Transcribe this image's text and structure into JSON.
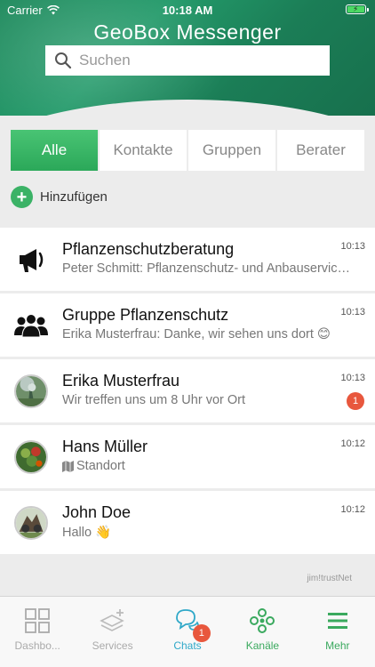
{
  "status_bar": {
    "carrier": "Carrier",
    "time": "10:18 AM"
  },
  "header": {
    "title": "GeoBox Messenger"
  },
  "search": {
    "placeholder": "Suchen",
    "value": ""
  },
  "segments": [
    {
      "label": "Alle",
      "active": true
    },
    {
      "label": "Kontakte",
      "active": false
    },
    {
      "label": "Gruppen",
      "active": false
    },
    {
      "label": "Berater",
      "active": false
    }
  ],
  "add": {
    "label": "Hinzufügen"
  },
  "chats": [
    {
      "name": "Pflanzenschutzberatung",
      "preview": "Peter Schmitt: Pflanzenschutz- und Anbauservice ...",
      "time": "10:13",
      "icon": "megaphone-icon"
    },
    {
      "name": "Gruppe Pflanzenschutz",
      "preview": "Erika Musterfrau: Danke, wir sehen uns dort 😊",
      "time": "10:13",
      "icon": "group-icon"
    },
    {
      "name": "Erika Musterfrau",
      "preview": "Wir treffen uns um 8 Uhr vor Ort",
      "time": "10:13",
      "unread": "1",
      "icon": "avatar-photo"
    },
    {
      "name": "Hans Müller",
      "preview": "Standort",
      "time": "10:12",
      "icon": "avatar-photo"
    },
    {
      "name": "John Doe",
      "preview": "Hallo 👋",
      "time": "10:12",
      "icon": "avatar-photo"
    }
  ],
  "footer": {
    "brand": "jim!trustNet"
  },
  "tabs": [
    {
      "label": "Dashbo...",
      "icon": "dashboard-icon",
      "color": "#aaaaaa"
    },
    {
      "label": "Services",
      "icon": "services-icon",
      "color": "#aaaaaa"
    },
    {
      "label": "Chats",
      "icon": "chat-icon",
      "color": "#2fa8c8",
      "badge": "1"
    },
    {
      "label": "Kanäle",
      "icon": "channels-icon",
      "color": "#3aa95e"
    },
    {
      "label": "Mehr",
      "icon": "menu-icon",
      "color": "#3aa95e"
    }
  ],
  "colors": {
    "accent_green": "#2ba859",
    "active_tab": "#2fa8c8",
    "badge_red": "#e8573d"
  }
}
